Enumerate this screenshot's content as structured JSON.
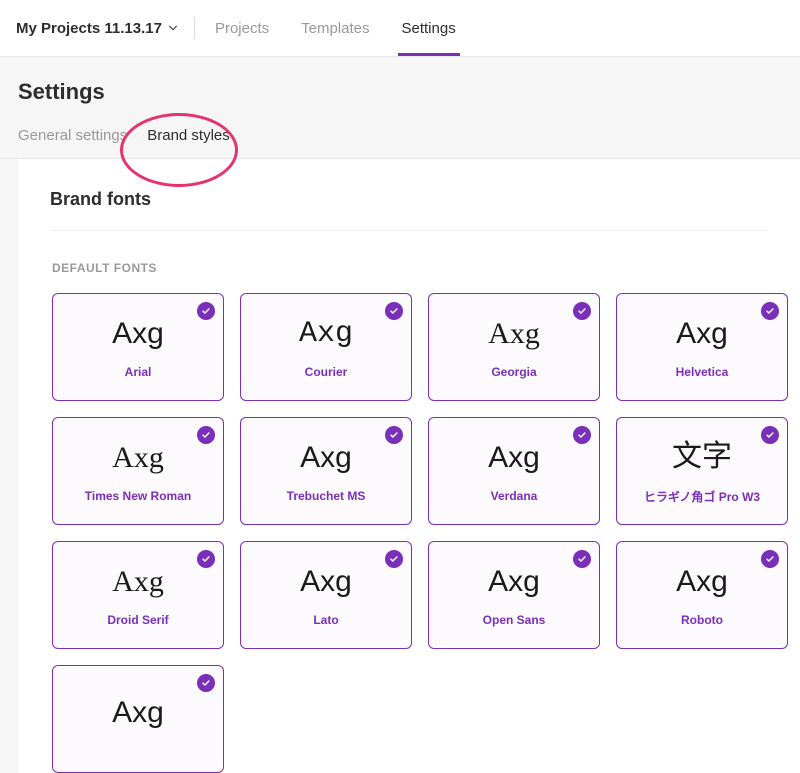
{
  "header": {
    "project_name": "My Projects 11.13.17",
    "nav": {
      "projects": "Projects",
      "templates": "Templates",
      "settings": "Settings"
    }
  },
  "page": {
    "title": "Settings",
    "subtabs": {
      "general": "General settings",
      "brand": "Brand styles"
    }
  },
  "brand_fonts": {
    "section_title": "Brand fonts",
    "default_label": "DEFAULT FONTS",
    "fonts": [
      {
        "name": "Arial",
        "sample": "Axg",
        "family": "Arial, sans-serif"
      },
      {
        "name": "Courier",
        "sample": "Axg",
        "family": "'Courier New', Courier, monospace"
      },
      {
        "name": "Georgia",
        "sample": "Axg",
        "family": "Georgia, serif"
      },
      {
        "name": "Helvetica",
        "sample": "Axg",
        "family": "Helvetica, Arial, sans-serif"
      },
      {
        "name": "Times New Roman",
        "sample": "Axg",
        "family": "'Times New Roman', Times, serif"
      },
      {
        "name": "Trebuchet MS",
        "sample": "Axg",
        "family": "'Trebuchet MS', sans-serif"
      },
      {
        "name": "Verdana",
        "sample": "Axg",
        "family": "Verdana, sans-serif"
      },
      {
        "name": "ヒラギノ角ゴ Pro W3",
        "sample": "文字",
        "family": "'Hiragino Kaku Gothic Pro', 'Yu Gothic', sans-serif"
      },
      {
        "name": "Droid Serif",
        "sample": "Axg",
        "family": "Georgia, serif"
      },
      {
        "name": "Lato",
        "sample": "Axg",
        "family": "Helvetica, Arial, sans-serif"
      },
      {
        "name": "Open Sans",
        "sample": "Axg",
        "family": "Helvetica, Arial, sans-serif"
      },
      {
        "name": "Roboto",
        "sample": "Axg",
        "family": "Helvetica, Arial, sans-serif"
      },
      {
        "name": "",
        "sample": "Axg",
        "family": "Helvetica, Arial, sans-serif"
      }
    ]
  }
}
